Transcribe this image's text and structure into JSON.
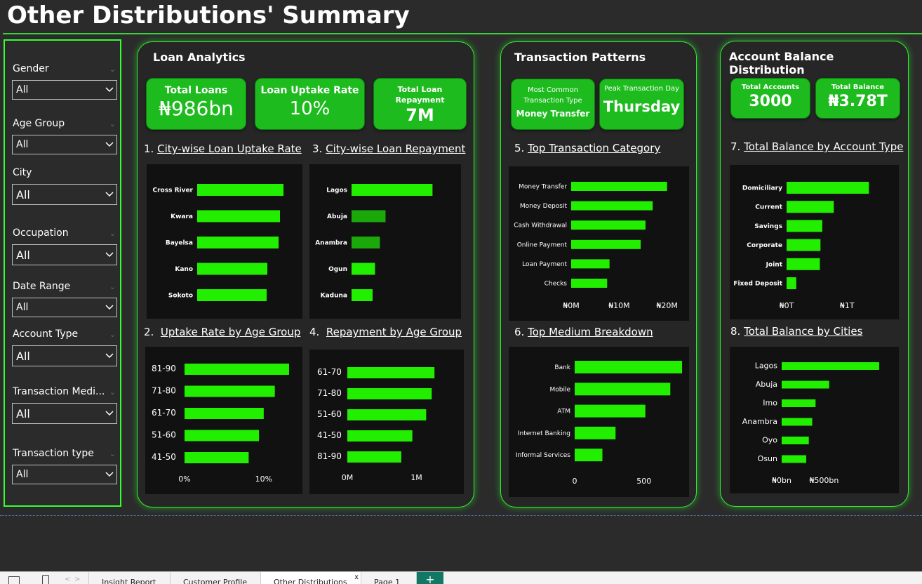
{
  "page_title": "Other Distributions' Summary",
  "filters": [
    {
      "label": "Gender",
      "value": "All"
    },
    {
      "label": "Age Group",
      "value": "All"
    },
    {
      "label": "City",
      "value": "All"
    },
    {
      "label": "Occupation",
      "value": "All"
    },
    {
      "label": "Date Range",
      "value": "All"
    },
    {
      "label": "Account Type",
      "value": "All"
    },
    {
      "label": "Transaction Medi...",
      "value": "All"
    },
    {
      "label": "Transaction type",
      "value": "All"
    }
  ],
  "loan": {
    "title": "Loan Analytics",
    "kpi1_label": "Total Loans",
    "kpi1_value": "₦986bn",
    "kpi2_label": "Loan Uptake Rate",
    "kpi2_value": "10%",
    "kpi3_label": "Total Loan Repayment",
    "kpi3_value": "7M",
    "sec1_num": "1.",
    "sec1_title": "City-wise Loan Uptake Rate",
    "sec2_num": "2.",
    "sec2_title": "Uptake Rate by Age Group",
    "sec3_num": "3.",
    "sec3_title": "City-wise Loan Repayment",
    "sec4_num": "4.",
    "sec4_title": "Repayment by Age Group"
  },
  "txn": {
    "title": "Transaction Patterns",
    "kpi1_label": "Most Common Transaction Type",
    "kpi1_value": "Money Transfer",
    "kpi2_label": "Peak Transaction Day",
    "kpi2_value": "Thursday",
    "sec5_num": "5.",
    "sec5_title": "Top Transaction Category",
    "sec6_num": "6.",
    "sec6_title": "Top Medium Breakdown"
  },
  "acct": {
    "title": "Account Balance Distribution",
    "kpi1_label": "Total Accounts",
    "kpi1_value": "3000",
    "kpi2_label": "Total Balance",
    "kpi2_value": "₦3.78T",
    "sec7_num": "7.",
    "sec7_title": "Total Balance by Account Type",
    "sec8_num": "8.",
    "sec8_title": "Total Balance by Cities"
  },
  "colors": {
    "bar": "#22ee00",
    "bar_dark": "#1aa80a",
    "accent": "#33ff33",
    "kpi": "#1dbb1d"
  },
  "tabs": [
    "Insight Report",
    "Customer Profile",
    "Other Distributions",
    "Page 1"
  ],
  "chart_data": [
    {
      "id": "c1",
      "type": "bar",
      "orientation": "horizontal",
      "categories": [
        "Cross River",
        "Kwara",
        "Bayelsa",
        "Kano",
        "Sokoto"
      ],
      "values": [
        0.123,
        0.118,
        0.116,
        0.1,
        0.099
      ],
      "xticks": [],
      "xlim": [
        0,
        0.15
      ]
    },
    {
      "id": "c3",
      "type": "bar",
      "orientation": "horizontal",
      "categories": [
        "Lagos",
        "Abuja",
        "Anambra",
        "Ogun",
        "Kaduna"
      ],
      "values": [
        1.0,
        0.42,
        0.35,
        0.29,
        0.26
      ],
      "xticks": [],
      "xlim": [
        0,
        1.3
      ],
      "highlight": [
        0,
        3,
        4
      ]
    },
    {
      "id": "c2",
      "type": "bar",
      "orientation": "horizontal",
      "categories": [
        "81-90",
        "71-80",
        "61-70",
        "51-60",
        "41-50"
      ],
      "values": [
        0.132,
        0.114,
        0.1,
        0.094,
        0.081
      ],
      "xticks": [
        "0%",
        "10%"
      ],
      "xtick_values": [
        0,
        0.1
      ],
      "xlim": [
        0,
        0.14
      ]
    },
    {
      "id": "c4",
      "type": "bar",
      "orientation": "horizontal",
      "categories": [
        "61-70",
        "71-80",
        "51-60",
        "41-50",
        "81-90"
      ],
      "values": [
        1.26,
        1.22,
        1.14,
        0.94,
        0.78
      ],
      "xticks": [
        "0M",
        "1M"
      ],
      "xtick_values": [
        0,
        1
      ],
      "xlim": [
        0,
        1.4
      ]
    },
    {
      "id": "c5",
      "type": "bar",
      "orientation": "horizontal",
      "categories": [
        "Money Transfer",
        "Money Deposit",
        "Cash Withdrawal",
        "Online Payment",
        "Loan Payment",
        "Checks"
      ],
      "values": [
        20,
        17,
        15.5,
        14.5,
        8,
        7.5
      ],
      "xticks": [
        "₦0M",
        "₦10M",
        "₦20M"
      ],
      "xtick_values": [
        0,
        10,
        20
      ],
      "xlim": [
        0,
        24
      ]
    },
    {
      "id": "c6",
      "type": "bar",
      "orientation": "horizontal",
      "categories": [
        "Bank",
        "Mobile",
        "ATM",
        "Internet Banking",
        "Informal Services"
      ],
      "values": [
        775,
        690,
        510,
        295,
        200
      ],
      "xticks": [
        "0",
        "500"
      ],
      "xtick_values": [
        0,
        500
      ],
      "xlim": [
        0,
        800
      ]
    },
    {
      "id": "c7",
      "type": "bar",
      "orientation": "horizontal",
      "categories": [
        "Domiciliary",
        "Current",
        "Savings",
        "Corporate",
        "Joint",
        "Fixed Deposit"
      ],
      "values": [
        1.36,
        0.78,
        0.59,
        0.56,
        0.55,
        0.16
      ],
      "xticks": [
        "₦0T",
        "₦1T"
      ],
      "xtick_values": [
        0,
        1
      ],
      "xlim": [
        0,
        1.6
      ]
    },
    {
      "id": "c8",
      "type": "bar",
      "orientation": "horizontal",
      "categories": [
        "Lagos",
        "Abuja",
        "Imo",
        "Anambra",
        "Oyo",
        "Osun"
      ],
      "values": [
        1150,
        560,
        400,
        360,
        320,
        290
      ],
      "xticks": [
        "₦0bn",
        "₦500bn"
      ],
      "xtick_values": [
        0,
        500
      ],
      "xlim": [
        0,
        1200
      ]
    }
  ]
}
